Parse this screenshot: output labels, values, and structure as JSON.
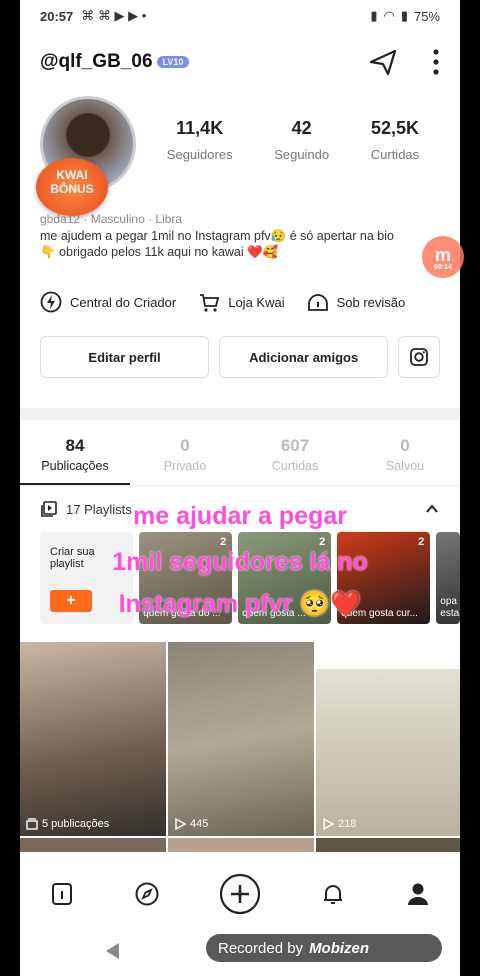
{
  "status": {
    "time": "20:57",
    "battery": "75%"
  },
  "header": {
    "username": "@qlf_GB_06",
    "level": "LV10"
  },
  "avatar": {
    "badge_line1": "KWAI",
    "badge_line2": "BÔNUS"
  },
  "stats": [
    {
      "value": "11,4K",
      "label": "Seguidores"
    },
    {
      "value": "42",
      "label": "Seguindo"
    },
    {
      "value": "52,5K",
      "label": "Curtidas"
    }
  ],
  "meta": {
    "handle": "gbda12",
    "gender": "Masculino",
    "sign": "Libra"
  },
  "bio": "me ajudem a pegar 1mil no Instagram pfv😥 é só apertar na bio 👇 obrigado pelos 11k aqui no kawai ❤️🥰",
  "tools": {
    "creator": "Central do Criador",
    "shop": "Loja Kwai",
    "review": "Sob revisão"
  },
  "buttons": {
    "edit": "Editar perfil",
    "add": "Adicionar amigos"
  },
  "tabs": [
    {
      "count": "84",
      "label": "Publicações"
    },
    {
      "count": "0",
      "label": "Privado"
    },
    {
      "count": "607",
      "label": "Curtidas"
    },
    {
      "count": "0",
      "label": "Salvou"
    }
  ],
  "playlists": {
    "header": "17 Playlists",
    "create_label": "Criar sua playlist",
    "items": [
      {
        "count": "2",
        "caption": "quem gosta do ..."
      },
      {
        "count": "2",
        "caption": "quem gosta ..."
      },
      {
        "count": "2",
        "caption": "quem gosta cur..."
      },
      {
        "count": "",
        "caption": "opa esta"
      }
    ]
  },
  "videos": [
    {
      "footer": "5 publicações"
    },
    {
      "footer": "445"
    },
    {
      "footer": "218"
    }
  ],
  "overlay": {
    "line1": "me ajudar a pegar",
    "line2": "1mil seguidores lá no",
    "line3": "Instagram pfvr 🥺❤️"
  },
  "recorder": {
    "label": "Recorded by",
    "brand": "Mobizen"
  },
  "floating": {
    "label": "m",
    "time": "00:14"
  },
  "colors": {
    "accent": "#ff6a1a",
    "overlay_text": "#ff4fd8",
    "level_badge": "#7a8cf0"
  }
}
